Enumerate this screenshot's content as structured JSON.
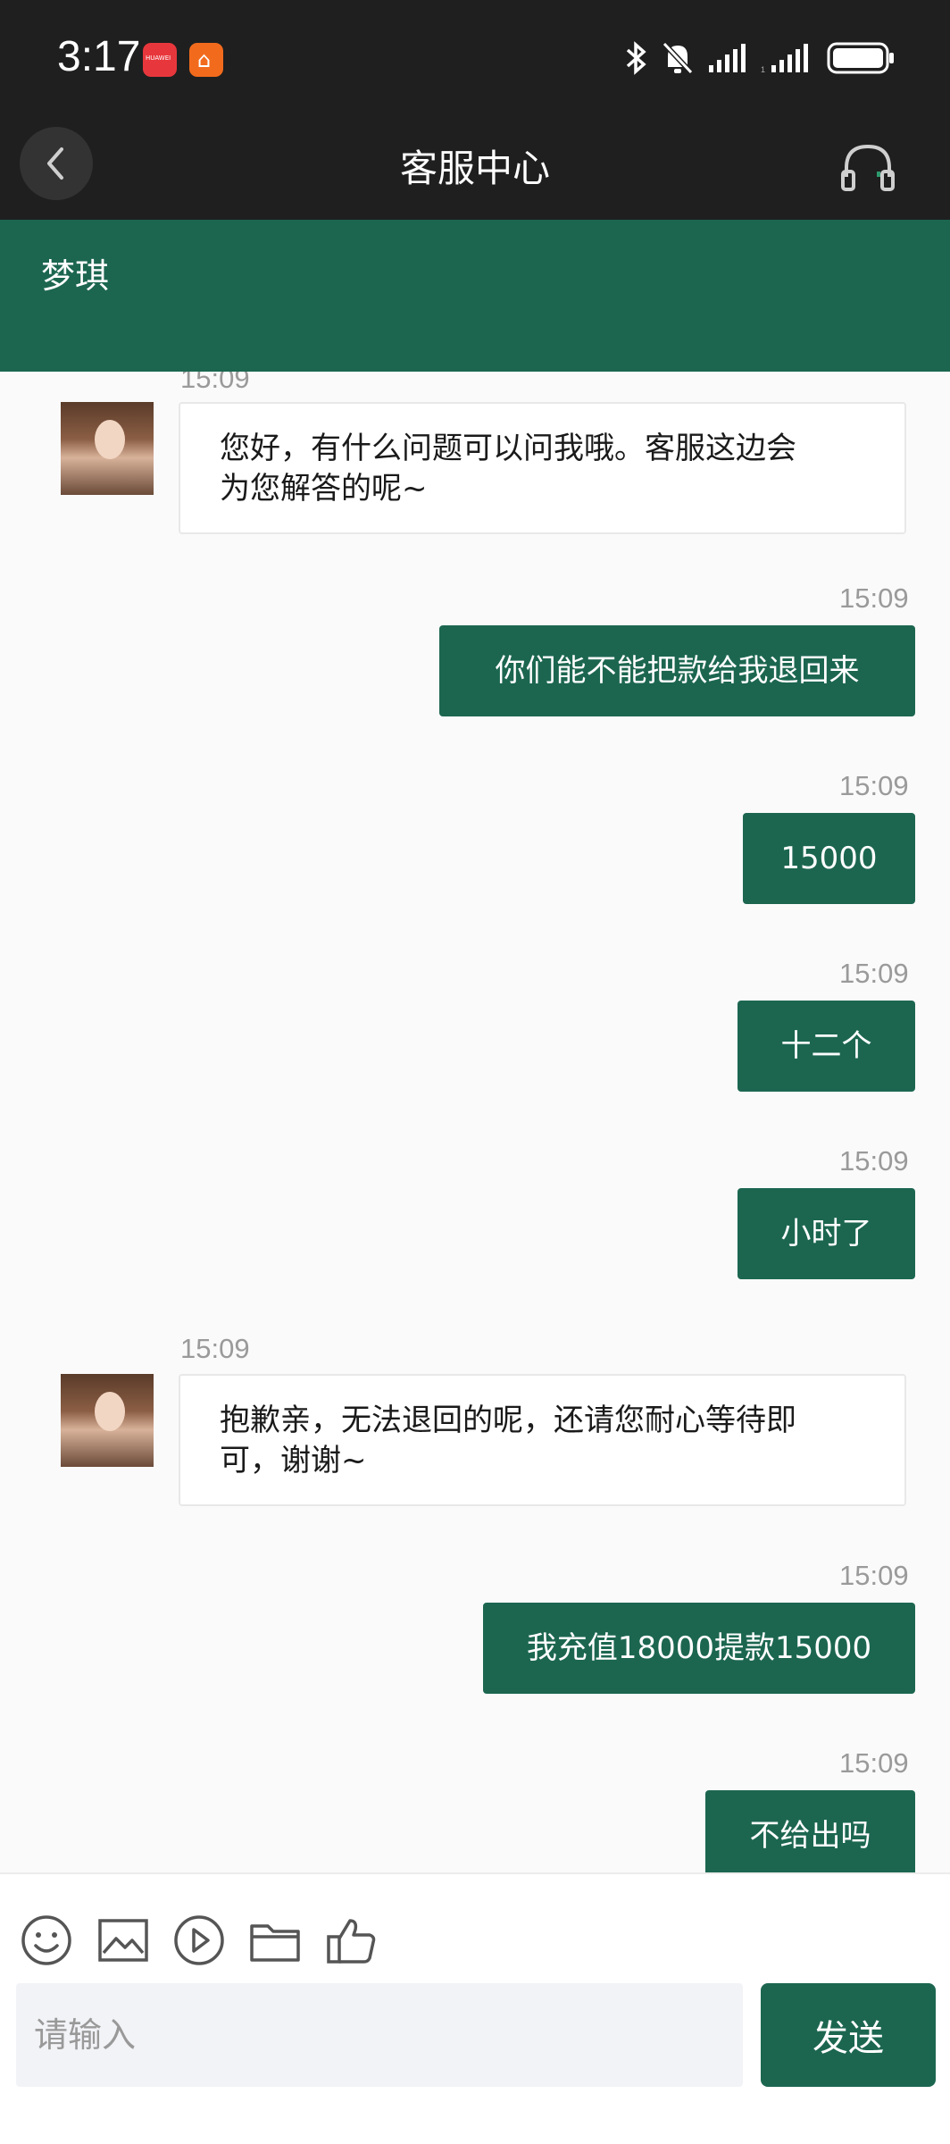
{
  "status_bar": {
    "time": "3:17"
  },
  "header": {
    "title": "客服中心"
  },
  "agent": {
    "name": "梦琪"
  },
  "messages": [
    {
      "dir": "in",
      "time": "15:09",
      "lines": [
        "您好，有什么问题可以问我哦。客服这边会",
        "为您解答的呢~"
      ]
    },
    {
      "dir": "out",
      "time": "15:09",
      "text": "你们能不能把款给我退回来"
    },
    {
      "dir": "out",
      "time": "15:09",
      "text": "15000"
    },
    {
      "dir": "out",
      "time": "15:09",
      "text": "十二个"
    },
    {
      "dir": "out",
      "time": "15:09",
      "text": "小时了"
    },
    {
      "dir": "in",
      "time": "15:09",
      "lines": [
        "抱歉亲，无法退回的呢，还请您耐心等待即",
        "可，谢谢~"
      ]
    },
    {
      "dir": "out",
      "time": "15:09",
      "text": "我充值18000提款15000"
    },
    {
      "dir": "out",
      "time": "15:09",
      "text": "不给出吗"
    }
  ],
  "composer": {
    "placeholder": "请输入",
    "send_label": "发送"
  },
  "colors": {
    "accent": "#1c6650",
    "topbar": "#1f1f1f"
  }
}
